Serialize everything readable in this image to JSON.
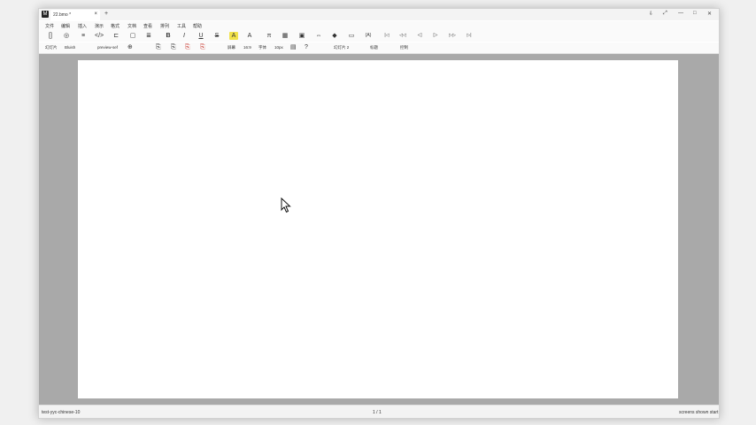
{
  "tab": {
    "title": "22.bmo *",
    "close": "×"
  },
  "titlebar": {
    "new_tab": "+",
    "pin": "⇩",
    "expand": "⤢",
    "minimize": "—",
    "maximize": "□",
    "close": "✕",
    "logo": "M"
  },
  "menu": [
    "文件",
    "编辑",
    "插入",
    "演示",
    "格式",
    "文档",
    "查看",
    "排列",
    "工具",
    "帮助"
  ],
  "toolbar_icons": [
    {
      "name": "bracket-icon",
      "glyph": "[]"
    },
    {
      "name": "palette-icon",
      "glyph": "◎"
    },
    {
      "name": "list-icon",
      "glyph": "≡"
    },
    {
      "name": "code-icon",
      "glyph": "</>"
    },
    {
      "name": "tree-icon",
      "glyph": "⊏"
    },
    {
      "name": "comment-icon",
      "glyph": "▢"
    },
    {
      "name": "align-icon",
      "glyph": "≣"
    },
    {
      "name": "bold-icon",
      "glyph": "B"
    },
    {
      "name": "italic-icon",
      "glyph": "I"
    },
    {
      "name": "underline-icon",
      "glyph": "U"
    },
    {
      "name": "strikethrough-icon",
      "glyph": "S"
    },
    {
      "name": "highlight-icon",
      "glyph": "A"
    },
    {
      "name": "font-color-icon",
      "glyph": "A"
    },
    {
      "name": "formula-icon",
      "glyph": "π"
    },
    {
      "name": "table-icon",
      "glyph": "▦"
    },
    {
      "name": "image-icon",
      "glyph": "▣"
    },
    {
      "name": "link-icon",
      "glyph": "⇔"
    },
    {
      "name": "fill-icon",
      "glyph": "◆"
    },
    {
      "name": "calendar-icon",
      "glyph": "▭"
    },
    {
      "name": "variable-icon",
      "glyph": "{A}"
    },
    {
      "name": "first-slide-icon",
      "glyph": "|◁"
    },
    {
      "name": "prev-slide-icon",
      "glyph": "◁◁"
    },
    {
      "name": "prev-icon",
      "glyph": "◁"
    },
    {
      "name": "play-icon",
      "glyph": "▷"
    },
    {
      "name": "next-slide-icon",
      "glyph": "▷▷"
    },
    {
      "name": "last-slide-icon",
      "glyph": "▷|"
    }
  ],
  "subbar": {
    "slide_label": "幻灯片",
    "theme_value": "Bluish",
    "preview_value": "preview-sef",
    "screen_label": "屏幕",
    "ratio_value": "16:9",
    "font_label": "字体",
    "font_size": "10px",
    "slide_two": "幻灯片 2",
    "title_label": "标题",
    "control_label": "控制"
  },
  "status": {
    "left": "test-yyc-chinese-10",
    "center": "1 / 1",
    "right": "screens shown start"
  },
  "colors": {
    "highlight": "#f1e24a",
    "workspace": "#a9a9a9",
    "accent_red": "#c8342a"
  }
}
